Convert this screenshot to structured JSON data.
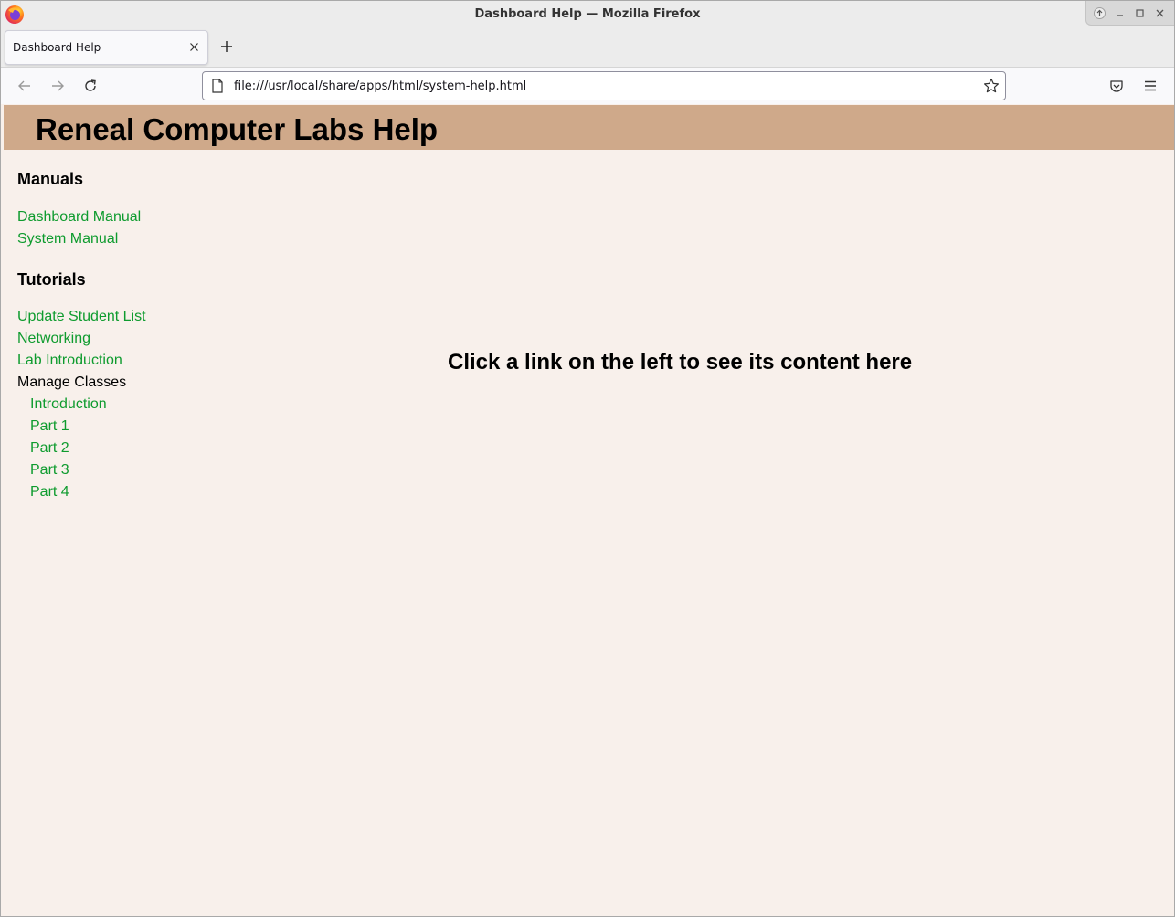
{
  "window": {
    "title": "Dashboard Help — Mozilla Firefox"
  },
  "tabs": [
    {
      "label": "Dashboard Help"
    }
  ],
  "navbar": {
    "url": "file:///usr/local/share/apps/html/system-help.html"
  },
  "page": {
    "title": "Reneal Computer Labs Help",
    "sidebar": {
      "manuals_heading": "Manuals",
      "manuals": [
        "Dashboard Manual",
        "System Manual"
      ],
      "tutorials_heading": "Tutorials",
      "tutorials": [
        "Update Student List",
        "Networking",
        "Lab Introduction"
      ],
      "manage_classes_label": "Manage Classes",
      "manage_classes_items": [
        "Introduction",
        "Part 1",
        "Part 2",
        "Part 3",
        "Part 4"
      ]
    },
    "main_message": "Click a link on the left to see its content here"
  },
  "colors": {
    "header_bg": "#cfa98a",
    "page_bg": "#f8f0eb",
    "link": "#0e9b2e"
  }
}
